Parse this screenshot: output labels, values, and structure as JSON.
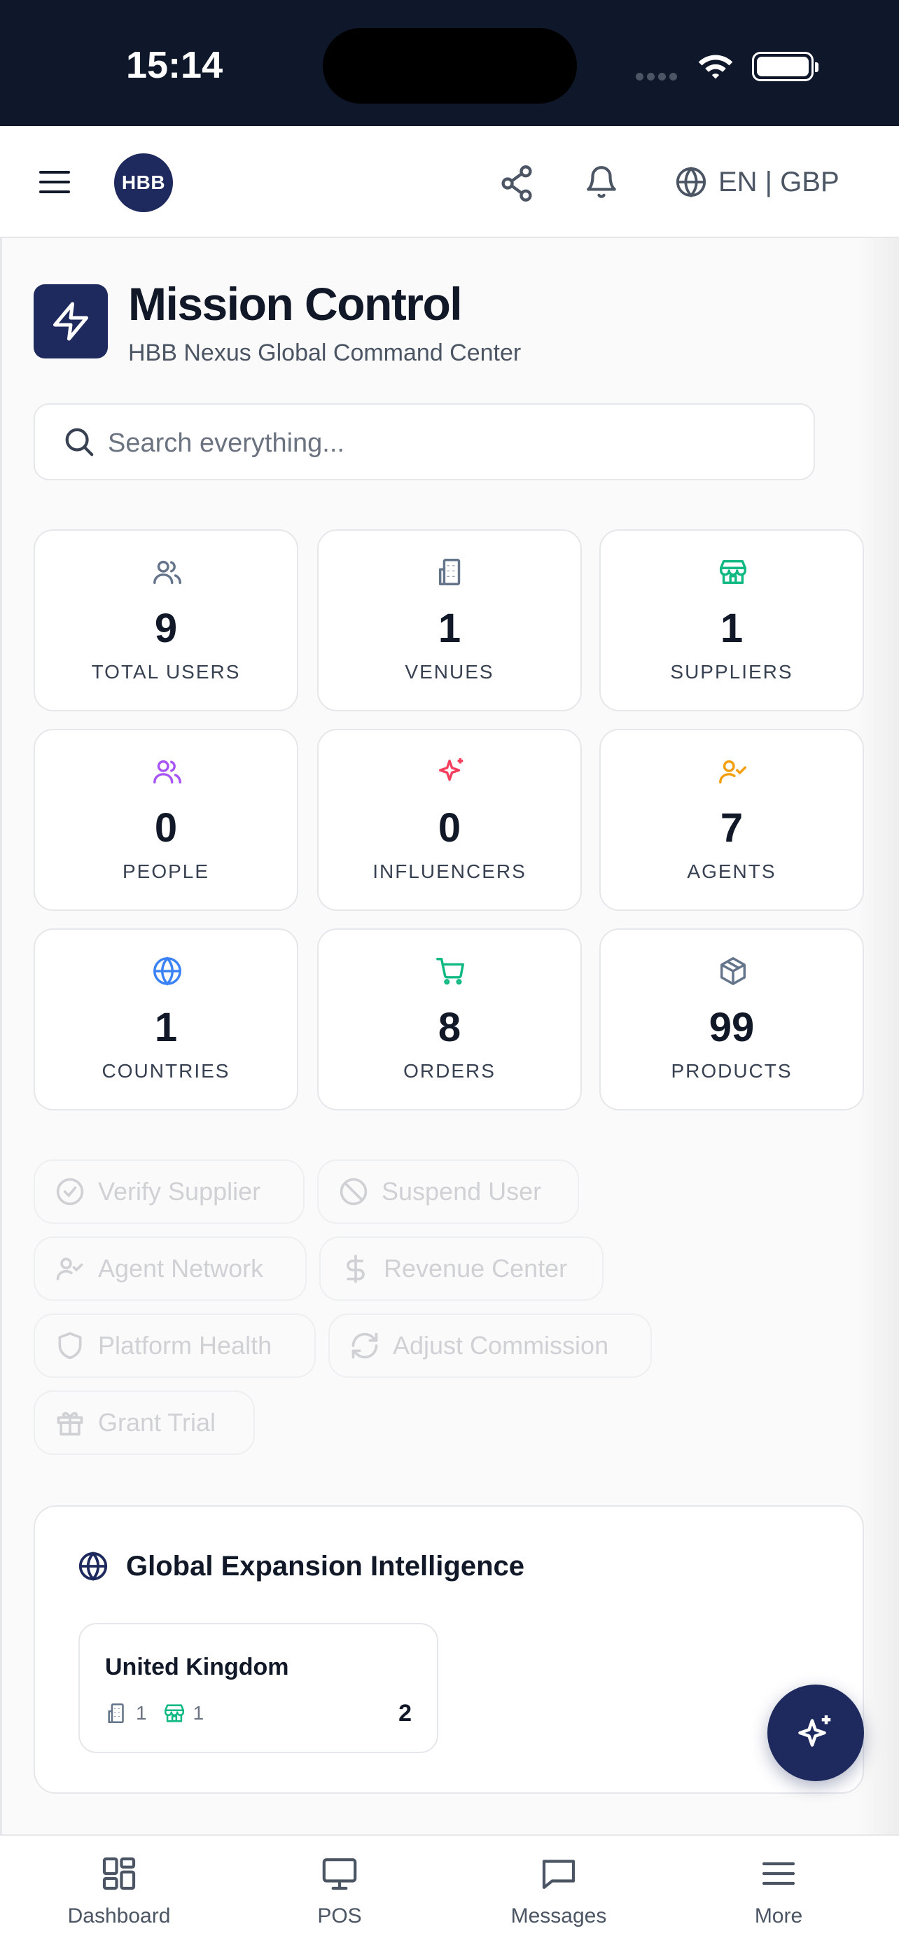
{
  "status_bar": {
    "time": "15:14"
  },
  "top_bar": {
    "brand_badge": "HBB",
    "locale": "EN | GBP"
  },
  "header": {
    "title": "Mission Control",
    "subtitle": "HBB Nexus Global Command Center"
  },
  "search": {
    "placeholder": "Search everything..."
  },
  "stats": [
    {
      "value": "9",
      "label": "TOTAL USERS",
      "icon": "users-icon",
      "color": "#64748b"
    },
    {
      "value": "1",
      "label": "VENUES",
      "icon": "building-icon",
      "color": "#64748b"
    },
    {
      "value": "1",
      "label": "SUPPLIERS",
      "icon": "store-icon",
      "color": "#10b981"
    },
    {
      "value": "0",
      "label": "PEOPLE",
      "icon": "users-icon",
      "color": "#a855f7"
    },
    {
      "value": "0",
      "label": "INFLUENCERS",
      "icon": "sparkles-icon",
      "color": "#f43f5e"
    },
    {
      "value": "7",
      "label": "AGENTS",
      "icon": "user-check-icon",
      "color": "#f59e0b"
    },
    {
      "value": "1",
      "label": "COUNTRIES",
      "icon": "globe-icon",
      "color": "#3b82f6"
    },
    {
      "value": "8",
      "label": "ORDERS",
      "icon": "cart-icon",
      "color": "#10b981"
    },
    {
      "value": "99",
      "label": "PRODUCTS",
      "icon": "package-icon",
      "color": "#64748b"
    }
  ],
  "quick_actions": [
    {
      "label": "Verify Supplier",
      "icon": "check-circle-icon"
    },
    {
      "label": "Suspend User",
      "icon": "ban-icon"
    },
    {
      "label": "Agent Network",
      "icon": "user-check-icon"
    },
    {
      "label": "Revenue Center",
      "icon": "dollar-icon"
    },
    {
      "label": "Platform Health",
      "icon": "shield-icon"
    },
    {
      "label": "Adjust Commission",
      "icon": "refresh-icon"
    },
    {
      "label": "Grant Trial",
      "icon": "gift-icon"
    }
  ],
  "expansion": {
    "title": "Global Expansion Intelligence",
    "countries": [
      {
        "name": "United Kingdom",
        "venues": "1",
        "suppliers": "1",
        "total": "2"
      }
    ]
  },
  "bottom_nav": [
    {
      "label": "Dashboard",
      "icon": "grid-icon"
    },
    {
      "label": "POS",
      "icon": "monitor-icon"
    },
    {
      "label": "Messages",
      "icon": "message-icon"
    },
    {
      "label": "More",
      "icon": "menu-icon"
    }
  ],
  "colors": {
    "brand_navy": "#1e2a5e",
    "status_bar": "#0f172a",
    "card_border": "#e5e7eb"
  }
}
